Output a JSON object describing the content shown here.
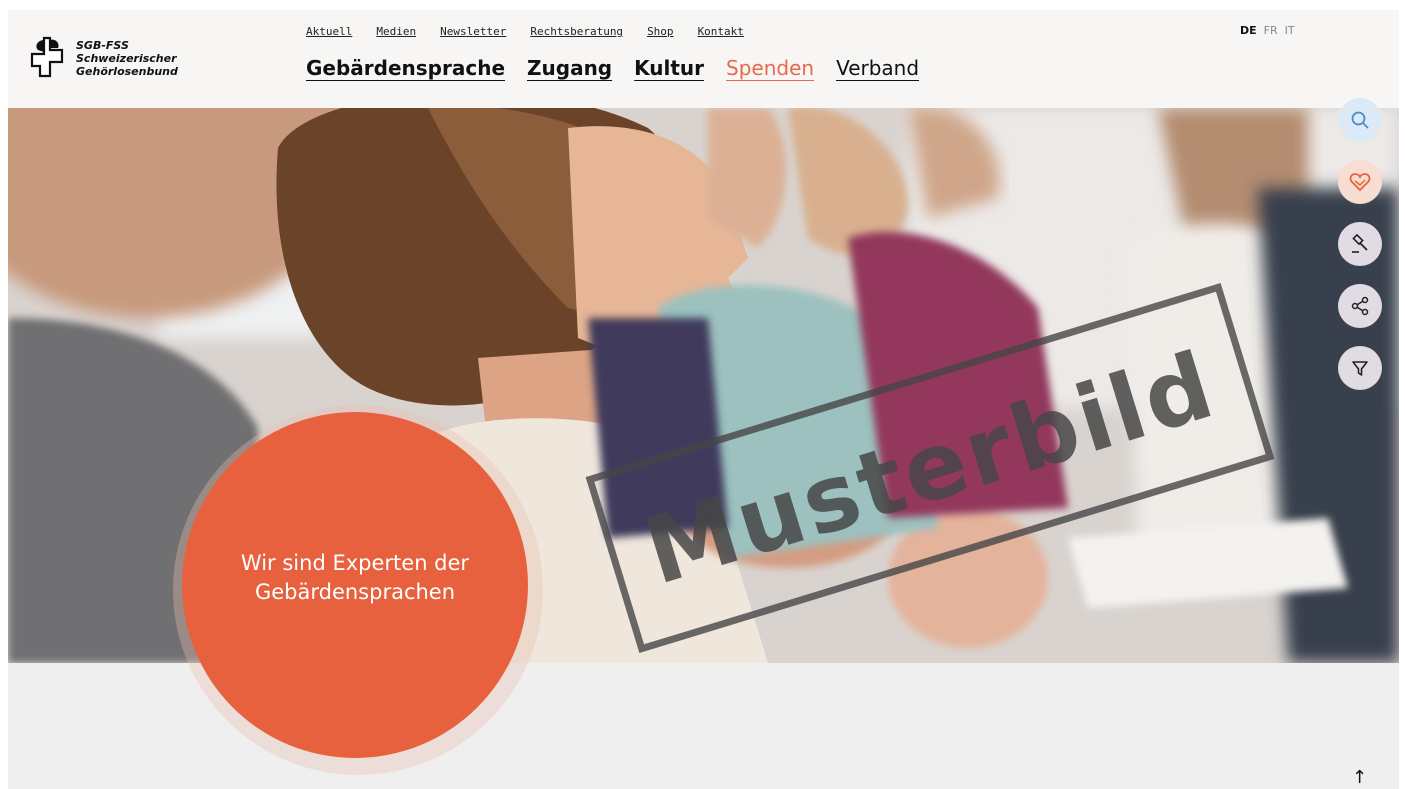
{
  "logo": {
    "line1": "SGB-FSS",
    "line2": "Schweizerischer",
    "line3": "Gehörlosenbund"
  },
  "top_links": [
    "Aktuell",
    "Medien",
    "Newsletter",
    "Rechtsberatung",
    "Shop",
    "Kontakt"
  ],
  "main_nav": [
    "Gebärdensprache",
    "Zugang",
    "Kultur",
    "Spenden",
    "Verband"
  ],
  "languages": {
    "de": "DE",
    "fr": "FR",
    "it": "IT"
  },
  "hero": {
    "stamp": "Musterbild",
    "claim_line1": "Wir sind Experten der",
    "claim_line2": "Gebärdensprachen"
  },
  "tools": [
    "search-icon",
    "donate-heart-icon",
    "legal-hammer-icon",
    "share-icon",
    "filter-icon"
  ],
  "back_to_top": "↑",
  "colors": {
    "accent": "#e7613e",
    "spenden": "#e8694a",
    "search_bg": "#dbeaf6",
    "donate_bg": "#f8ddd3",
    "tool_bg": "#e3dbe4"
  }
}
